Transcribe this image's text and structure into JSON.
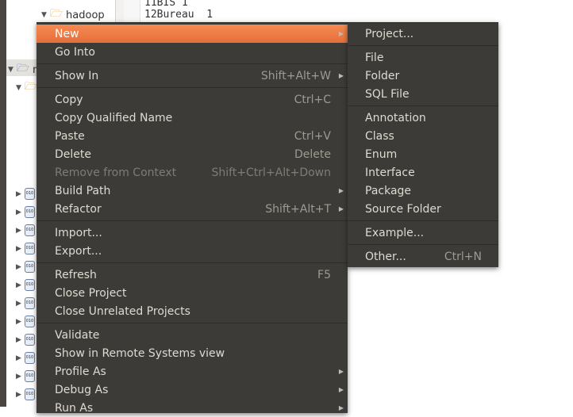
{
  "tree": {
    "folder": "hadoop",
    "project_partial": "m"
  },
  "editor": {
    "lines": [
      {
        "num": "11",
        "text": "BIS 1"
      },
      {
        "num": "12",
        "text": "Bureau  1"
      }
    ]
  },
  "context_menu": [
    {
      "label": "New",
      "submenu": true,
      "highlighted": true
    },
    {
      "label": "Go Into"
    },
    {
      "sep": true
    },
    {
      "label": "Show In",
      "shortcut": "Shift+Alt+W",
      "submenu": true
    },
    {
      "sep": true
    },
    {
      "label": "Copy",
      "shortcut": "Ctrl+C"
    },
    {
      "label": "Copy Qualified Name"
    },
    {
      "label": "Paste",
      "shortcut": "Ctrl+V"
    },
    {
      "label": "Delete",
      "shortcut": "Delete"
    },
    {
      "label": "Remove from Context",
      "shortcut": "Shift+Ctrl+Alt+Down",
      "disabled": true
    },
    {
      "label": "Build Path",
      "submenu": true
    },
    {
      "label": "Refactor",
      "shortcut": "Shift+Alt+T",
      "submenu": true
    },
    {
      "sep": true
    },
    {
      "label": "Import..."
    },
    {
      "label": "Export..."
    },
    {
      "sep": true
    },
    {
      "label": "Refresh",
      "shortcut": "F5"
    },
    {
      "label": "Close Project"
    },
    {
      "label": "Close Unrelated Projects"
    },
    {
      "sep": true
    },
    {
      "label": "Validate"
    },
    {
      "label": "Show in Remote Systems view"
    },
    {
      "label": "Profile As",
      "submenu": true
    },
    {
      "label": "Debug As",
      "submenu": true
    },
    {
      "label": "Run As",
      "submenu": true
    }
  ],
  "new_submenu": [
    {
      "label": "Project..."
    },
    {
      "sep": true
    },
    {
      "label": "File"
    },
    {
      "label": "Folder"
    },
    {
      "label": "SQL File"
    },
    {
      "sep": true
    },
    {
      "label": "Annotation"
    },
    {
      "label": "Class"
    },
    {
      "label": "Enum"
    },
    {
      "label": "Interface"
    },
    {
      "label": "Package"
    },
    {
      "label": "Source Folder"
    },
    {
      "sep": true
    },
    {
      "label": "Example..."
    },
    {
      "sep": true
    },
    {
      "label": "Other...",
      "shortcut": "Ctrl+N"
    }
  ],
  "colors": {
    "menu_bg": "#3c3b37",
    "highlight": "#f07746",
    "text": "#dfdbd2",
    "disabled": "#7f7c75"
  }
}
